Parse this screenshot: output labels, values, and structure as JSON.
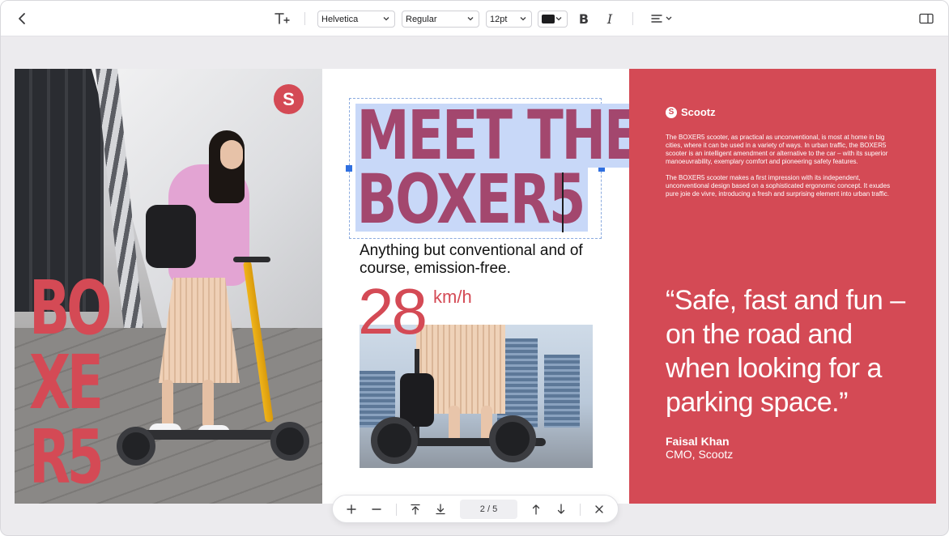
{
  "toolbar": {
    "font_family": "Helvetica",
    "font_weight": "Regular",
    "font_size": "12pt",
    "text_color": "#1d1d1f",
    "bold_label": "B",
    "italic_label": "I"
  },
  "page_left": {
    "logo_letter": "S",
    "vertical_word": [
      "BO",
      "XE",
      "R5"
    ]
  },
  "page_middle": {
    "headline_line1": "MEET THE",
    "headline_line2": "BOXER5",
    "subhead": "Anything but conventional and of course, emission-free.",
    "speed_value": "28",
    "speed_unit": "km/h"
  },
  "page_right": {
    "brand": "Scootz",
    "brand_letter": "S",
    "paragraph1": "The BOXER5 scooter, as practical as unconventional, is most at home in big cities, where it can be used in a variety of ways. In urban traffic, the BOXER5 scooter is an intelligent amendment or alternative to the car – with its superior manoeuvrability, exemplary comfort and pioneering safety features.",
    "paragraph2": "The BOXER5 scooter makes a first impression with its independent, unconventional design based on a sophisticated ergonomic concept. It exudes pure joie de vivre, introducing a fresh and surprising element into urban traffic.",
    "quote": "“Safe, fast and fun – on the road and when looking for a parking space.”",
    "author_name": "Faisal Khan",
    "author_role": "CMO, Scootz"
  },
  "pagebar": {
    "page_indicator": "2 / 5"
  },
  "colors": {
    "accent_red": "#d44a55",
    "headline_plum": "#a3476e",
    "selection_blue": "#c8d8f8",
    "handle_blue": "#2f6fe0"
  }
}
